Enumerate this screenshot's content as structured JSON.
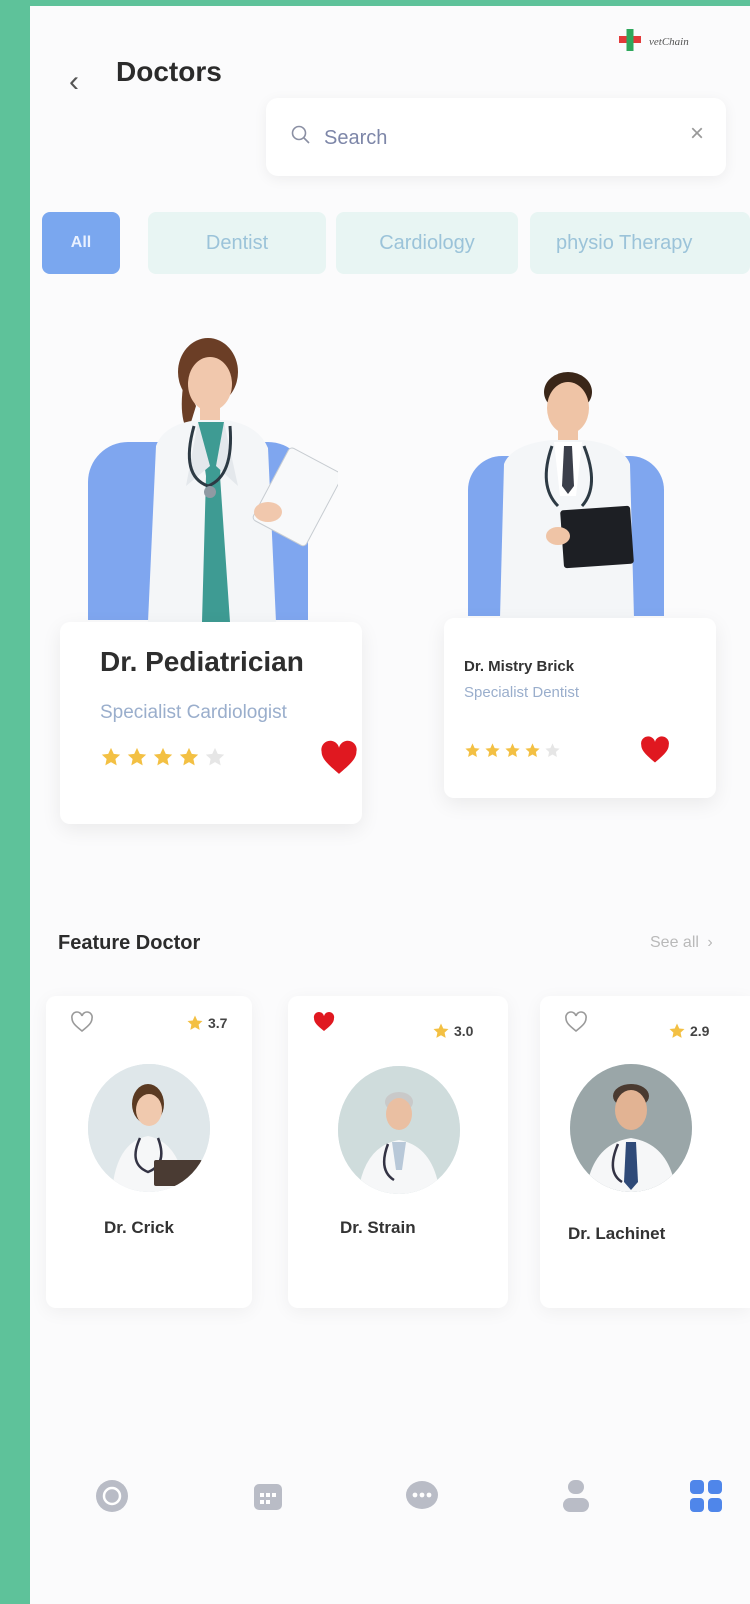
{
  "header": {
    "title": "Doctors",
    "logo_text": "vetChain"
  },
  "search": {
    "placeholder": "Search"
  },
  "categories": [
    {
      "label": "All",
      "active": true
    },
    {
      "label": "Dentist",
      "active": false
    },
    {
      "label": "Cardiology",
      "active": false
    },
    {
      "label": "physio Therapy",
      "active": false
    }
  ],
  "doctors": [
    {
      "name": "Dr. Pediatrician",
      "specialty": "Specialist Cardiologist",
      "rating": 4,
      "favorite": true
    },
    {
      "name": "Dr. Mistry Brick",
      "specialty": "Specialist Dentist",
      "rating": 4,
      "favorite": true
    }
  ],
  "featured": {
    "title": "Feature Doctor",
    "see_all": "See all",
    "items": [
      {
        "name": "Dr. Crick",
        "rating": "3.7",
        "favorite": false
      },
      {
        "name": "Dr. Strain",
        "rating": "3.0",
        "favorite": true
      },
      {
        "name": "Dr. Lachinet",
        "rating": "2.9",
        "favorite": false
      }
    ]
  },
  "colors": {
    "accent": "#7aa7ef",
    "frame": "#5ec29a",
    "heart": "#e01820",
    "star": "#f3c043"
  },
  "icons": {
    "back": "chevron-left-icon",
    "search": "search-icon",
    "clear": "close-icon",
    "nav": [
      "home-icon",
      "calendar-icon",
      "chat-icon",
      "profile-icon",
      "grid-icon"
    ]
  }
}
